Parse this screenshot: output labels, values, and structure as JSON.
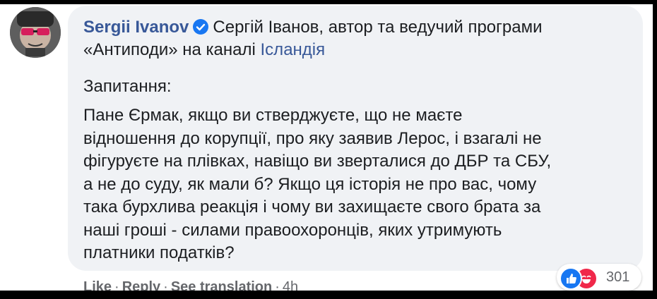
{
  "comment": {
    "author": "Sergii Ivanov",
    "header_text": "Сергій Іванов, автор та ведучий програми",
    "header_line2_prefix": "«Антиподи» на каналі",
    "header_link": "Ісландія",
    "question_label": "Запитання:",
    "body_lines": [
      "Пане Єрмак, якщо ви стверджуєте, що не маєте",
      "відношення до корупції, про яку заявив Лерос, і взагалі не",
      "фігуруєте на плівках, навіщо ви зверталися до ДБР та СБУ,",
      "а не до суду, як мали б? Якщо ця історія не про вас, чому",
      "така бурхлива реакція і чому ви захищаєте свого брата за",
      "наші гроші - силами правоохоронців, яких утримують",
      "платники податків?"
    ]
  },
  "reactions": {
    "count": "301",
    "icons": [
      "like-icon",
      "haha-icon"
    ]
  },
  "actions": {
    "like": "Like",
    "reply": "Reply",
    "see_translation": "See translation",
    "time": "4h",
    "separator": "·"
  },
  "colors": {
    "link": "#385898",
    "bubble": "#f0f2f5",
    "like": "#1877f2",
    "haha": "#f0284a"
  }
}
